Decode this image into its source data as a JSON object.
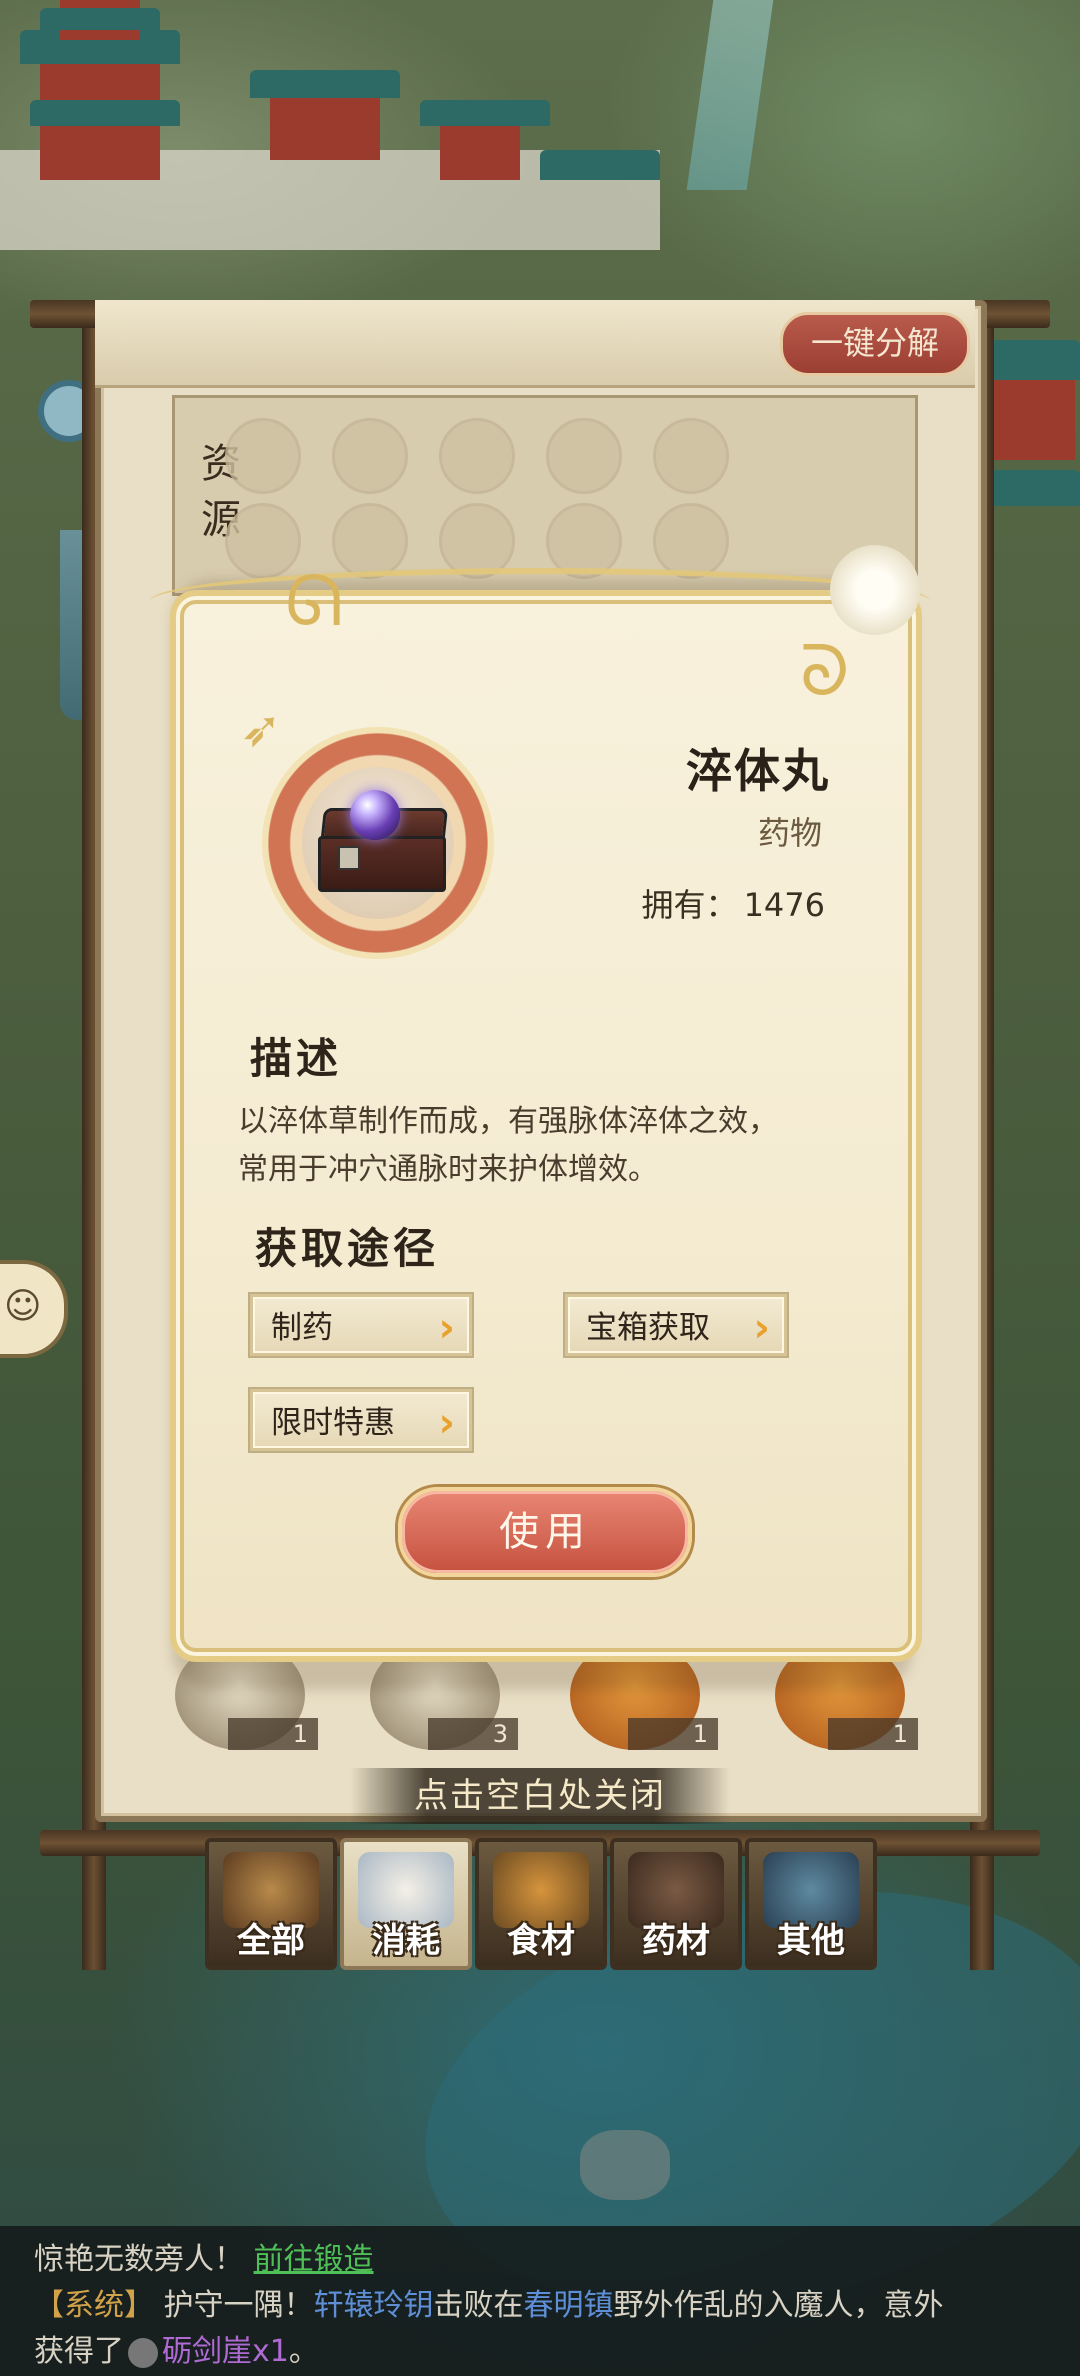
{
  "modal": {
    "item_name": "淬体丸",
    "item_type": "药物",
    "own_label": "拥有：",
    "own_count": "1476",
    "desc_title": "描述",
    "desc_line1": "以淬体草制作而成，有强脉体淬体之效，",
    "desc_line2": "常用于冲穴通脉时来护体增效。",
    "ways_title": "获取途径",
    "ways": [
      "制药",
      "宝箱获取",
      "限时特惠"
    ],
    "arrow": "›",
    "use_label": "使用"
  },
  "panel": {
    "oneclick_label": "一键分解",
    "resource_label": "资源",
    "close_hint": "点击空白处关闭",
    "counts": [
      "1",
      "3",
      "1",
      "1"
    ]
  },
  "tabs": [
    "全部",
    "消耗",
    "食材",
    "药材",
    "其他"
  ],
  "chat": {
    "line1_text": "惊艳无数旁人！",
    "line1_link": "前往锻造",
    "line2_tag": "【系统】",
    "line2_a": "护守一隅！",
    "line2_player": "轩辕玲钥",
    "line2_b": "击败在",
    "line2_place": "春明镇",
    "line2_c": "野外作乱的入魔人，意外",
    "line3_a": "获得了",
    "line3_item": "砺剑崖x1",
    "line3_b": "。"
  }
}
